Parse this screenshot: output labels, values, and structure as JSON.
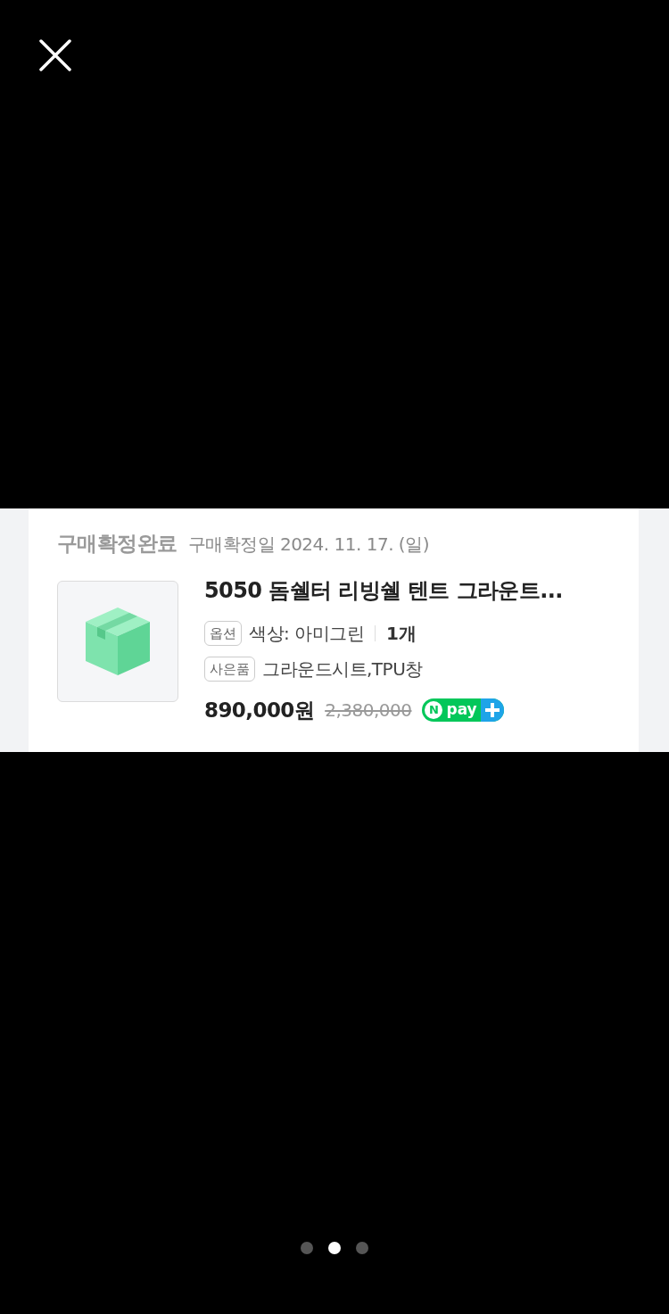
{
  "order": {
    "status": "구매확정완료",
    "confirm_date": "구매확정일 2024. 11. 17. (일)",
    "product_title": "5050 돔쉘터 리빙쉘 텐트 그라운트...",
    "details": [
      {
        "tag": "옵션",
        "value": "색상: 아미그린",
        "quantity": "1개"
      },
      {
        "tag": "사은품",
        "value": "그라운드시트,TPU창"
      }
    ],
    "price": "890,000원",
    "original_price": "2,380,000",
    "pay_badge": {
      "n": "N",
      "pay": "pay"
    }
  },
  "pager": [
    {
      "selected": false
    },
    {
      "selected": true
    },
    {
      "selected": false
    }
  ]
}
